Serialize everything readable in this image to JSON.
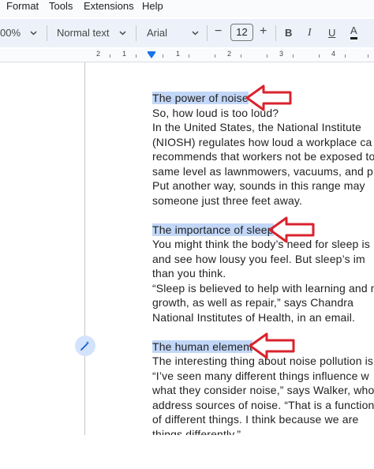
{
  "menubar": {
    "format": "Format",
    "tools": "Tools",
    "extensions": "Extensions",
    "help": "Help"
  },
  "toolbar": {
    "zoom": "00%",
    "style": "Normal text",
    "font": "Arial",
    "minus": "−",
    "font_size": "12",
    "plus": "+",
    "bold": "B",
    "italic": "I",
    "underline": "U",
    "text_color": "A"
  },
  "ruler": {
    "labels": [
      "2",
      "1",
      "1",
      "2",
      "3",
      "4"
    ]
  },
  "document": {
    "lines": [
      "The power of noise",
      "So, how loud is too loud?",
      "In the United States, the National Institute",
      "(NIOSH) regulates how loud a workplace ca",
      "recommends that workers not be exposed to",
      "same level as lawnmowers, vacuums, and p",
      "Put another way, sounds in this range may",
      "someone just three feet away.",
      "The importance of sleep",
      "You might think the body’s need for sleep is",
      "and see how lousy you feel. But sleep’s im",
      "than you think.",
      "“Sleep is believed to help with learning and m",
      "growth, as well as repair,” says Chandra",
      "National Institutes of Health, in an email.",
      "The human element",
      "The interesting thing about noise pollution is t",
      "“I’ve seen many different things influence w",
      "what they consider noise,” says Walker, who",
      "address sources of noise. “That is a function",
      "of different things. I think because we are",
      "things differently.”"
    ]
  },
  "colors": {
    "highlight": "#c2d7f7",
    "arrow": "#d9232d",
    "accent": "#1a73e8"
  },
  "icons": {
    "zoom_dropdown": "chevron-down-icon",
    "style_dropdown": "chevron-down-icon",
    "font_dropdown": "chevron-down-icon",
    "ai_button": "magic-pen-icon",
    "annotation": "red-arrow-icon"
  }
}
